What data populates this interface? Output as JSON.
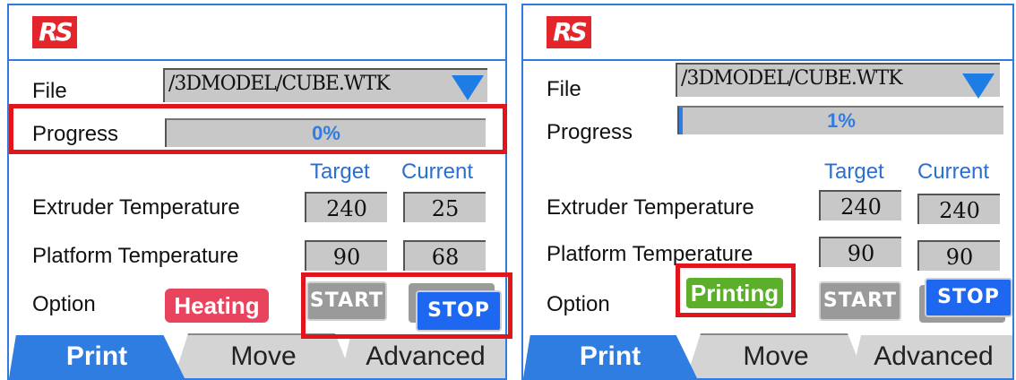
{
  "panels": [
    {
      "logo": "RS",
      "file_label": "File",
      "file_value": "/3DMODEL/CUBE.WTK",
      "progress_label": "Progress",
      "progress_text": "0%",
      "progress_fraction": 0.0,
      "target_header": "Target",
      "current_header": "Current",
      "extruder_label": "Extruder Temperature",
      "extruder_target": "240",
      "extruder_current": "25",
      "platform_label": "Platform Temperature",
      "platform_target": "90",
      "platform_current": "68",
      "option_label": "Option",
      "status": "Heating",
      "start_label": "START",
      "stop_label": "STOP",
      "tabs": [
        "Print",
        "Move",
        "Advanced"
      ]
    },
    {
      "logo": "RS",
      "file_label": "File",
      "file_value": "/3DMODEL/CUBE.WTK",
      "progress_label": "Progress",
      "progress_text": "1%",
      "progress_fraction": 0.01,
      "target_header": "Target",
      "current_header": "Current",
      "extruder_label": "Extruder Temperature",
      "extruder_target": "240",
      "extruder_current": "240",
      "platform_label": "Platform Temperature",
      "platform_target": "90",
      "platform_current": "90",
      "option_label": "Option",
      "status": "Printing",
      "start_label": "START",
      "stop_label": "STOP",
      "tabs": [
        "Print",
        "Move",
        "Advanced"
      ]
    }
  ],
  "colors": {
    "accent": "#2f7de0",
    "heating": "#e8445e",
    "printing": "#5caf2a",
    "stop": "#1e67f0",
    "start": "#9a9a9a",
    "highlight_box": "#e0161c"
  }
}
